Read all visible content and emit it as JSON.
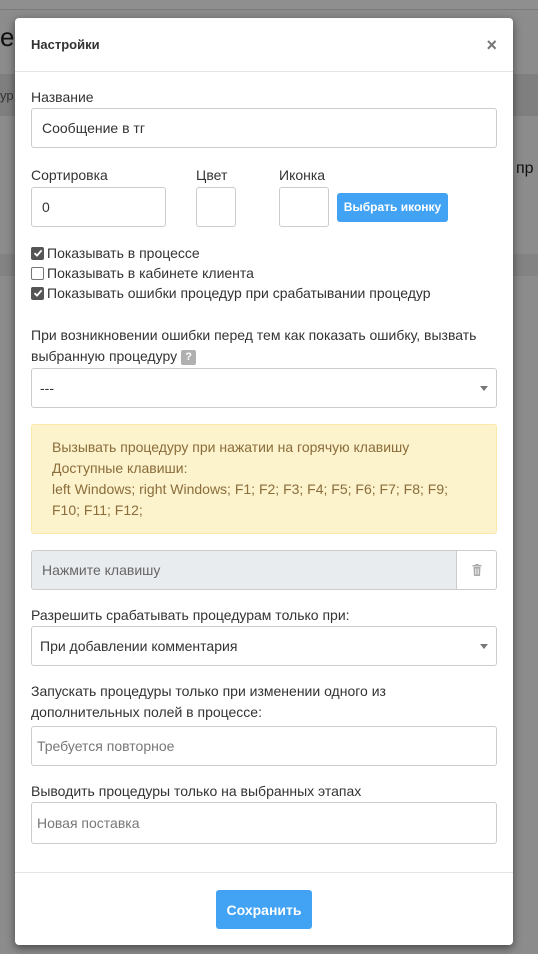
{
  "background": {
    "left_fragment_1": "е",
    "left_fragment_2": "ур",
    "right_fragment": "пр"
  },
  "modal": {
    "title": "Настройки",
    "close_symbol": "×",
    "name": {
      "label": "Название",
      "value": "Сообщение в тг"
    },
    "sort": {
      "label": "Сортировка",
      "value": "0"
    },
    "color": {
      "label": "Цвет",
      "value": ""
    },
    "icon": {
      "label": "Иконка",
      "button_label": "Выбрать иконку"
    },
    "checkboxes": [
      {
        "label": "Показывать в процессе",
        "checked": true
      },
      {
        "label": "Показывать в кабинете клиента",
        "checked": false
      },
      {
        "label": "Показывать ошибки процедур при срабатывании процедур",
        "checked": true
      }
    ],
    "error_procedure": {
      "label": "При возникновении ошибки перед тем как показать ошибку, вызвать выбранную процедуру",
      "help_symbol": "?",
      "selected": "---"
    },
    "hotkey_info": {
      "line1": "Вызывать процедуру при нажатии на горячую клавишу",
      "line2": "Доступные клавиши:",
      "line3": "left Windows; right Windows; F1; F2; F3; F4; F5; F6; F7; F8; F9; F10; F11; F12;"
    },
    "hotkey_input": {
      "placeholder": "Нажмите клавишу"
    },
    "allow_only": {
      "label": "Разрешить срабатывать процедурам только при:",
      "selected": "При добавлении комментария"
    },
    "run_only": {
      "label": "Запускать процедуры только при изменении одного из дополнительных полей в процессе:",
      "value": "Требуется повторное"
    },
    "stages": {
      "label": "Выводить процедуры только на выбранных этапах",
      "value": "Новая поставка"
    },
    "save_label": "Сохранить"
  },
  "colors": {
    "accent": "#42a3f5",
    "alert_bg": "#fcf2cc",
    "alert_text": "#8a6d3b",
    "overlay": "#8c8c8c"
  },
  "icons": [
    "close-icon",
    "checkmark-icon",
    "help-icon",
    "dropdown-arrow-icon",
    "trash-icon"
  ]
}
